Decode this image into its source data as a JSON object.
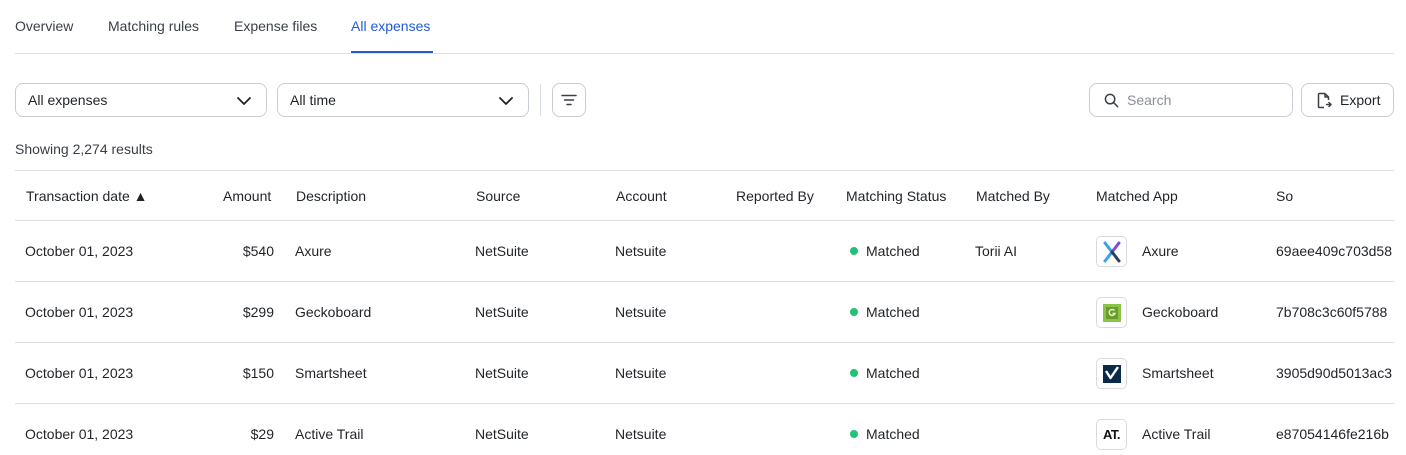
{
  "tabs": [
    {
      "label": "Overview"
    },
    {
      "label": "Matching rules"
    },
    {
      "label": "Expense files"
    },
    {
      "label": "All expenses",
      "active": true
    }
  ],
  "filters": {
    "expense_type": "All expenses",
    "time_range": "All time"
  },
  "search": {
    "placeholder": "Search"
  },
  "export_label": "Export",
  "results_text": "Showing 2,274 results",
  "colors": {
    "accent": "#1f5bd6",
    "matched": "#21c274"
  },
  "table": {
    "columns": [
      "Transaction date ▲",
      "Amount",
      "Description",
      "Source",
      "Account",
      "Reported By",
      "Matching Status",
      "Matched By",
      "Matched App",
      "Source ID"
    ],
    "rows": [
      {
        "date": "October 01, 2023",
        "amount": "$540",
        "description": "Axure",
        "source": "NetSuite",
        "account": "Netsuite",
        "reported_by": "",
        "status": "Matched",
        "matched_by": "Torii AI",
        "app": "Axure",
        "app_icon": "axure-logo",
        "source_id": "69aee409c703d58"
      },
      {
        "date": "October 01, 2023",
        "amount": "$299",
        "description": "Geckoboard",
        "source": "NetSuite",
        "account": "Netsuite",
        "reported_by": "",
        "status": "Matched",
        "matched_by": "",
        "app": "Geckoboard",
        "app_icon": "geckoboard-logo",
        "source_id": "7b708c3c60f5788"
      },
      {
        "date": "October 01, 2023",
        "amount": "$150",
        "description": "Smartsheet",
        "source": "NetSuite",
        "account": "Netsuite",
        "reported_by": "",
        "status": "Matched",
        "matched_by": "",
        "app": "Smartsheet",
        "app_icon": "smartsheet-logo",
        "source_id": "3905d90d5013ac3"
      },
      {
        "date": "October 01, 2023",
        "amount": "$29",
        "description": "Active Trail",
        "source": "NetSuite",
        "account": "Netsuite",
        "reported_by": "",
        "status": "Matched",
        "matched_by": "",
        "app": "Active Trail",
        "app_icon": "activetrail-logo",
        "app_logo_text": "AT.",
        "source_id": "e87054146fe216b"
      }
    ]
  }
}
